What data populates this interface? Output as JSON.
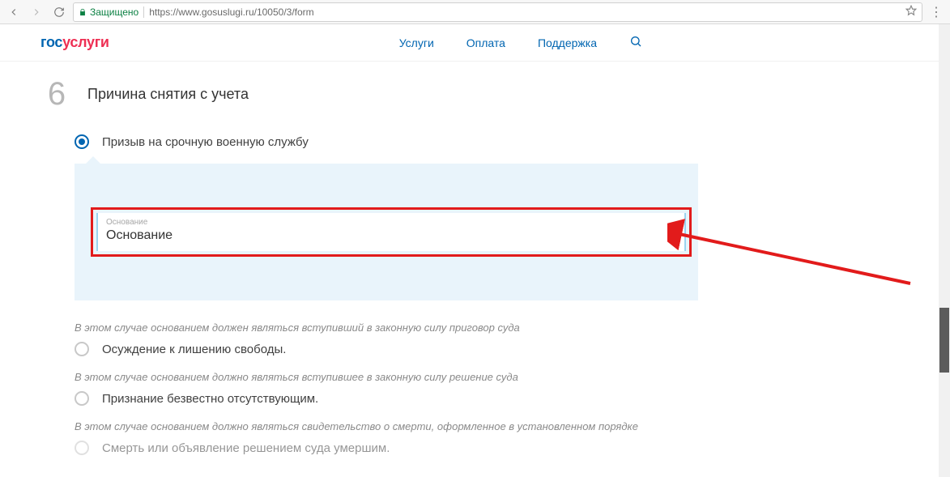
{
  "browser": {
    "secure_label": "Защищено",
    "url": "https://www.gosuslugi.ru/10050/3/form"
  },
  "logo": {
    "part1": "гос",
    "part2": "услуги"
  },
  "nav": {
    "services": "Услуги",
    "payment": "Оплата",
    "support": "Поддержка"
  },
  "step": {
    "num": "6",
    "title": "Причина снятия с учета"
  },
  "option1": {
    "label": "Призыв на срочную военную службу",
    "input_label": "Основание",
    "input_value": "Основание"
  },
  "option2": {
    "hint": "В этом случае основанием должен являться вступивший в законную силу приговор суда",
    "label": "Осуждение к лишению свободы."
  },
  "option3": {
    "hint": "В этом случае основанием должно являться вступившее в законную силу решение суда",
    "label": "Признание безвестно отсутствующим."
  },
  "option4": {
    "hint": "В этом случае основанием должно являться свидетельство о смерти, оформленное в установленном порядке",
    "label": "Смерть или объявление решением суда умершим."
  }
}
